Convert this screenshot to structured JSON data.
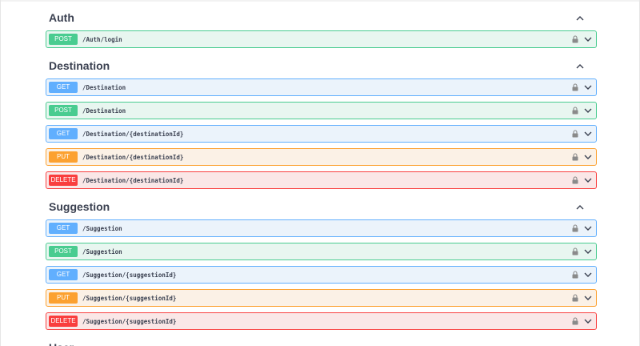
{
  "sections": [
    {
      "title": "Auth",
      "ops": [
        {
          "method": "POST",
          "path": "/Auth/login"
        }
      ]
    },
    {
      "title": "Destination",
      "ops": [
        {
          "method": "GET",
          "path": "/Destination"
        },
        {
          "method": "POST",
          "path": "/Destination"
        },
        {
          "method": "GET",
          "path": "/Destination/{destinationId}"
        },
        {
          "method": "PUT",
          "path": "/Destination/{destinationId}"
        },
        {
          "method": "DELETE",
          "path": "/Destination/{destinationId}"
        }
      ]
    },
    {
      "title": "Suggestion",
      "ops": [
        {
          "method": "GET",
          "path": "/Suggestion"
        },
        {
          "method": "POST",
          "path": "/Suggestion"
        },
        {
          "method": "GET",
          "path": "/Suggestion/{suggestionId}"
        },
        {
          "method": "PUT",
          "path": "/Suggestion/{suggestionId}"
        },
        {
          "method": "DELETE",
          "path": "/Suggestion/{suggestionId}"
        }
      ]
    },
    {
      "title": "User",
      "ops": []
    }
  ],
  "icons": {
    "collapse": "chevron-up-icon",
    "expand": "chevron-down-icon",
    "lock": "lock-icon"
  },
  "colors": {
    "get": "#61affe",
    "post": "#49cc90",
    "put": "#fca130",
    "delete": "#f93e3e",
    "text": "#3b4151"
  }
}
